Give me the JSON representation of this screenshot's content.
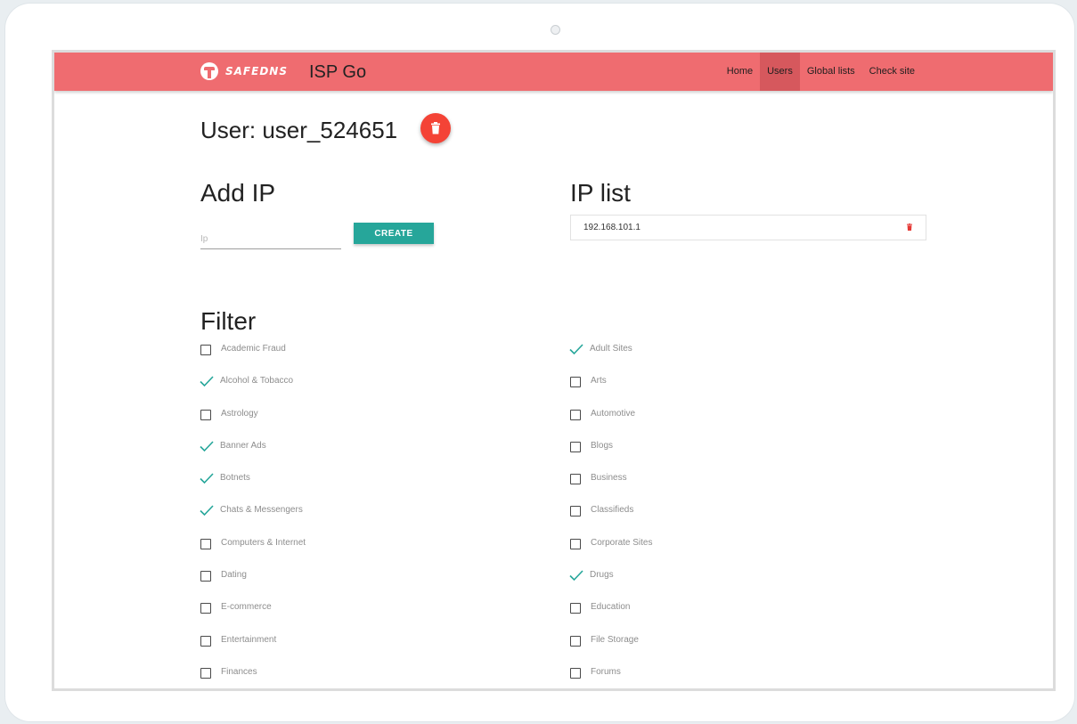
{
  "app": {
    "brand": "SAFEDNS",
    "title": "ISP Go"
  },
  "nav": [
    {
      "label": "Home",
      "active": false
    },
    {
      "label": "Users",
      "active": true
    },
    {
      "label": "Global lists",
      "active": false
    },
    {
      "label": "Check site",
      "active": false
    }
  ],
  "user": {
    "title": "User: user_524651"
  },
  "add_ip": {
    "heading": "Add IP",
    "placeholder": "Ip",
    "create_label": "CREATE"
  },
  "ip_list": {
    "heading": "IP list",
    "items": [
      "192.168.101.1"
    ]
  },
  "filter": {
    "heading": "Filter",
    "left": [
      {
        "label": "Academic Fraud",
        "checked": false
      },
      {
        "label": "Alcohol & Tobacco",
        "checked": true
      },
      {
        "label": "Astrology",
        "checked": false
      },
      {
        "label": "Banner Ads",
        "checked": true
      },
      {
        "label": "Botnets",
        "checked": true
      },
      {
        "label": "Chats & Messengers",
        "checked": true
      },
      {
        "label": "Computers & Internet",
        "checked": false
      },
      {
        "label": "Dating",
        "checked": false
      },
      {
        "label": "E-commerce",
        "checked": false
      },
      {
        "label": "Entertainment",
        "checked": false
      },
      {
        "label": "Finances",
        "checked": false
      }
    ],
    "right": [
      {
        "label": "Adult Sites",
        "checked": true
      },
      {
        "label": "Arts",
        "checked": false
      },
      {
        "label": "Automotive",
        "checked": false
      },
      {
        "label": "Blogs",
        "checked": false
      },
      {
        "label": "Business",
        "checked": false
      },
      {
        "label": "Classifieds",
        "checked": false
      },
      {
        "label": "Corporate Sites",
        "checked": false
      },
      {
        "label": "Drugs",
        "checked": true
      },
      {
        "label": "Education",
        "checked": false
      },
      {
        "label": "File Storage",
        "checked": false
      },
      {
        "label": "Forums",
        "checked": false
      }
    ]
  },
  "colors": {
    "appbar": "#ef6c70",
    "active_nav": "#d6585d",
    "accent": "#26a69a",
    "danger": "#f44336"
  }
}
